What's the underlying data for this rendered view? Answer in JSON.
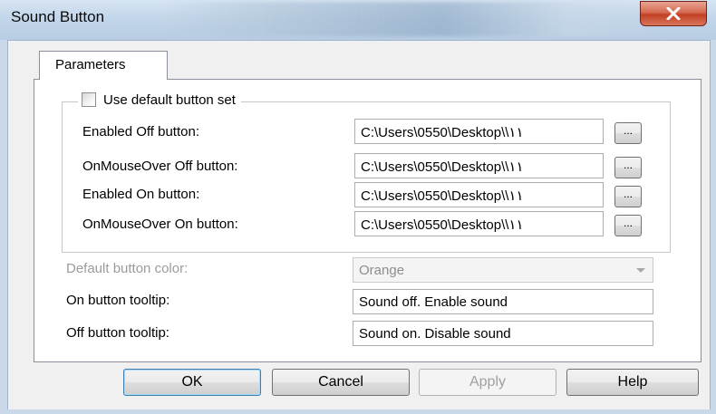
{
  "window": {
    "title": "Sound Button"
  },
  "tabs": [
    {
      "label": "Parameters"
    }
  ],
  "group": {
    "checkbox_label": "Use default button set",
    "checkbox_checked": false,
    "rows": [
      {
        "label": "Enabled Off button:",
        "value": "C:\\Users\\0550\\Desktop\\\\١١",
        "browse_label": "..."
      },
      {
        "label": "OnMouseOver Off button:",
        "value": "C:\\Users\\0550\\Desktop\\\\١١",
        "browse_label": "..."
      },
      {
        "label": "Enabled On button:",
        "value": "C:\\Users\\0550\\Desktop\\\\١١",
        "browse_label": "..."
      },
      {
        "label": "OnMouseOver On button:",
        "value": "C:\\Users\\0550\\Desktop\\\\١١",
        "browse_label": "..."
      }
    ]
  },
  "color": {
    "label": "Default button color:",
    "value": "Orange",
    "enabled": false
  },
  "on_tooltip": {
    "label": "On button tooltip:",
    "value": "Sound off. Enable sound"
  },
  "off_tooltip": {
    "label": "Off button tooltip:",
    "value": "Sound on. Disable sound"
  },
  "buttons": {
    "ok": "OK",
    "cancel": "Cancel",
    "apply": "Apply",
    "help": "Help"
  },
  "icons": {
    "close": "close-icon",
    "dropdown": "chevron-down-icon"
  },
  "colors": {
    "close_red": "#c9472b",
    "titlebar": "#c3d6ea",
    "default_button_border": "#3c7fb1"
  }
}
